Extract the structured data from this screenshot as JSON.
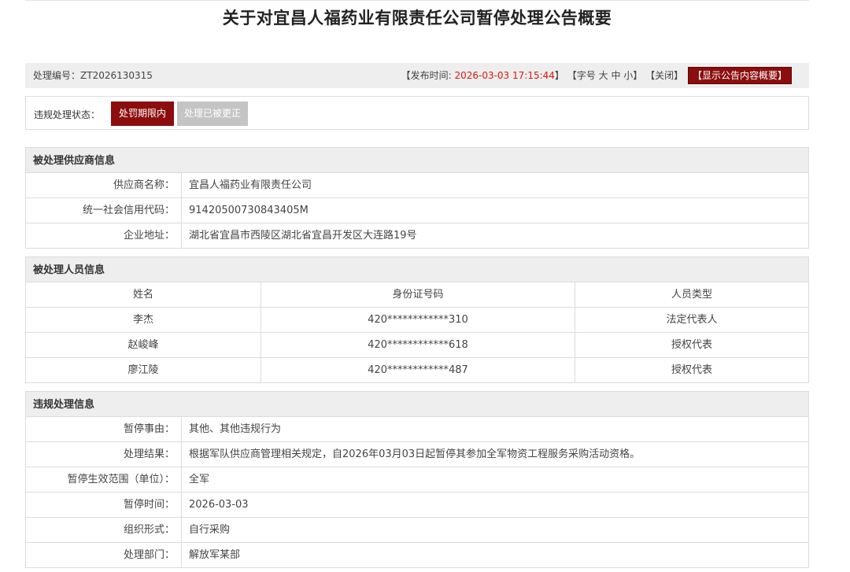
{
  "title": "关于对宜昌人福药业有限责任公司暂停处理公告概要",
  "meta": {
    "number_label": "处理编号：",
    "number_value": "ZT2026130315",
    "publish_prefix": "【发布时间:",
    "publish_time": "2026-03-03 17:15:44",
    "publish_suffix": "】",
    "font_open": "【字号",
    "font_large": "大",
    "font_medium": "中",
    "font_small": "小",
    "font_close": "】",
    "close_label": "【关闭】",
    "show_summary_label": "【显示公告内容概要】"
  },
  "status": {
    "label": "违规处理状态：",
    "active_button": "处罚期限内",
    "inactive_button": "处理已被更正"
  },
  "supplier": {
    "header": "被处理供应商信息",
    "rows": [
      {
        "key": "供应商名称：",
        "value": "宜昌人福药业有限责任公司"
      },
      {
        "key": "统一社会信用代码：",
        "value": "91420500730843405M"
      },
      {
        "key": "企业地址：",
        "value": "湖北省宜昌市西陵区湖北省宜昌开发区大连路19号"
      }
    ]
  },
  "persons": {
    "header": "被处理人员信息",
    "columns": [
      "姓名",
      "身份证号码",
      "人员类型"
    ],
    "rows": [
      [
        "李杰",
        "420************310",
        "法定代表人"
      ],
      [
        "赵峻峰",
        "420************618",
        "授权代表"
      ],
      [
        "廖江陵",
        "420************487",
        "授权代表"
      ]
    ]
  },
  "violation": {
    "header": "违规处理信息",
    "rows": [
      {
        "key": "暂停事由：",
        "value": "其他、其他违规行为"
      },
      {
        "key": "处理结果：",
        "value": "根据军队供应商管理相关规定，自2026年03月03日起暂停其参加全军物资工程服务采购活动资格。"
      },
      {
        "key": "暂停生效范围（单位）：",
        "value": "全军"
      },
      {
        "key": "暂停时间：",
        "value": "2026-03-03"
      },
      {
        "key": "组织形式：",
        "value": "自行采购"
      },
      {
        "key": "处理部门：",
        "value": "解放军某部"
      }
    ]
  }
}
